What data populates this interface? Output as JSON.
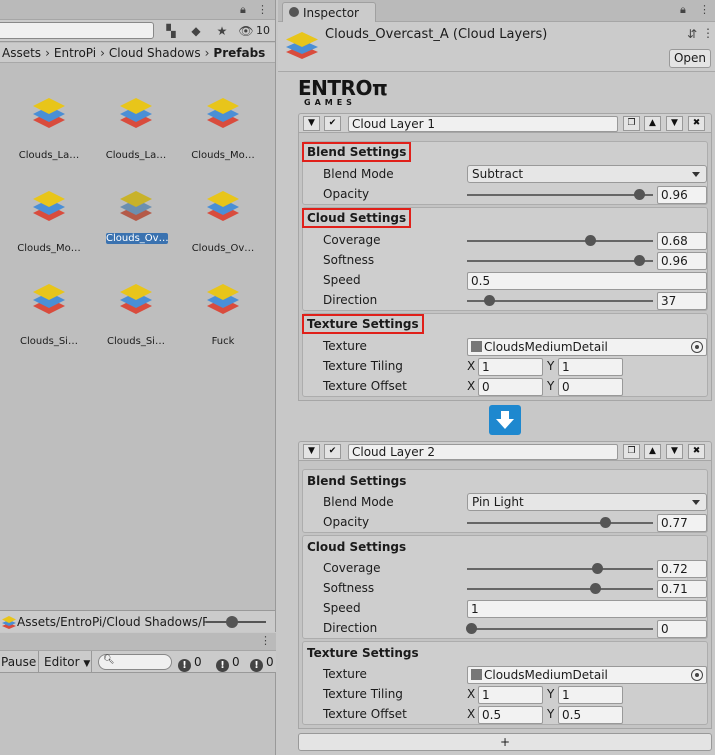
{
  "project": {
    "hidden_count": "10",
    "breadcrumb": [
      "Assets",
      "EntroPi",
      "Cloud Shadows",
      "Prefabs"
    ],
    "assets": [
      {
        "label": "Clouds_La…",
        "color_top": "#e8c51a"
      },
      {
        "label": "Clouds_La…",
        "color_top": "#e8c51a"
      },
      {
        "label": "Clouds_Mo…",
        "color_top": "#e8c51a"
      },
      {
        "label": "Clouds_Mo…",
        "color_top": "#e8c51a"
      },
      {
        "label": "Clouds_Ov…",
        "color_top": "#c8b22a",
        "selected": true
      },
      {
        "label": "Clouds_Ov…",
        "color_top": "#e8c51a"
      },
      {
        "label": "Clouds_Si…",
        "color_top": "#e8c51a"
      },
      {
        "label": "Clouds_Si…",
        "color_top": "#e8c51a"
      },
      {
        "label": "Fuck",
        "color_top": "#e8c51a"
      }
    ],
    "footer_path": "Assets/EntroPi/Cloud Shadows/Pr"
  },
  "console": {
    "pause_label": "Pause",
    "editor_label": "Editor",
    "log_count": "0",
    "warning_count": "0",
    "error_count": "0"
  },
  "inspector": {
    "tab_label": "Inspector",
    "title": "Clouds_Overcast_A (Cloud Layers)",
    "open_label": "Open",
    "logo_top": "ENTROπ",
    "logo_bottom": "GAMES",
    "add_label": "+",
    "layers": [
      {
        "name": "Cloud Layer 1",
        "blend_title": "Blend Settings",
        "blend_mode_label": "Blend Mode",
        "blend_mode": "Subtract",
        "opacity_label": "Opacity",
        "opacity": "0.96",
        "cloud_title": "Cloud Settings",
        "coverage_label": "Coverage",
        "coverage": "0.68",
        "softness_label": "Softness",
        "softness": "0.96",
        "speed_label": "Speed",
        "speed": "0.5",
        "direction_label": "Direction",
        "direction": "37",
        "texture_title": "Texture Settings",
        "texture_label": "Texture",
        "texture": "CloudsMediumDetail",
        "tiling_label": "Texture Tiling",
        "tiling_x": "1",
        "tiling_y": "1",
        "offset_label": "Texture Offset",
        "offset_x": "0",
        "offset_y": "0"
      },
      {
        "name": "Cloud Layer 2",
        "blend_title": "Blend Settings",
        "blend_mode_label": "Blend Mode",
        "blend_mode": "Pin Light",
        "opacity_label": "Opacity",
        "opacity": "0.77",
        "cloud_title": "Cloud Settings",
        "coverage_label": "Coverage",
        "coverage": "0.72",
        "softness_label": "Softness",
        "softness": "0.71",
        "speed_label": "Speed",
        "speed": "1",
        "direction_label": "Direction",
        "direction": "0",
        "texture_title": "Texture Settings",
        "texture_label": "Texture",
        "texture": "CloudsMediumDetail",
        "tiling_label": "Texture Tiling",
        "tiling_x": "1",
        "tiling_y": "1",
        "offset_label": "Texture Offset",
        "offset_x": "0.5",
        "offset_y": "0.5"
      }
    ]
  }
}
